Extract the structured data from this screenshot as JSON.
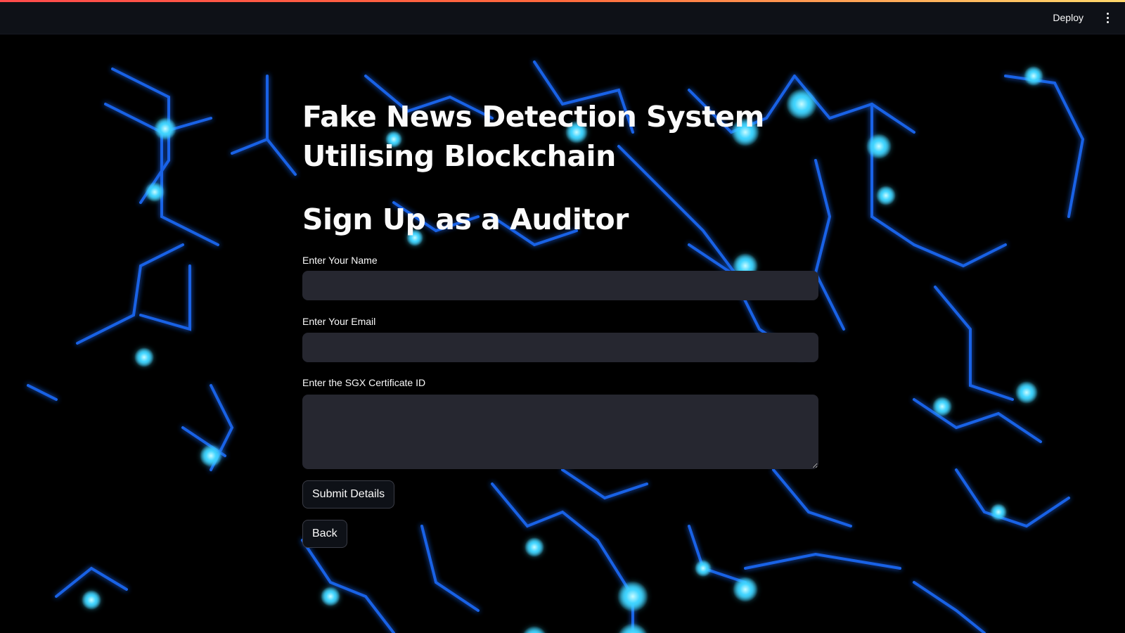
{
  "header": {
    "deploy_label": "Deploy",
    "menu_icon": "kebab-menu-icon"
  },
  "main": {
    "title": "Fake News Detection System Utilising Blockchain",
    "subtitle": "Sign Up as a Auditor",
    "fields": {
      "name": {
        "label": "Enter Your Name",
        "value": ""
      },
      "email": {
        "label": "Enter Your Email",
        "value": ""
      },
      "sgx_certificate_id": {
        "label": "Enter the SGX Certificate ID",
        "value": ""
      }
    },
    "submit_label": "Submit Details",
    "back_label": "Back"
  },
  "colors": {
    "header_bg": "#0e1117",
    "input_bg": "#262730",
    "accent_gradient_start": "#ff4b4b",
    "accent_gradient_end": "#ffd86b",
    "circuit_glow": "#3fd4ff",
    "circuit_line": "#1565ff"
  }
}
